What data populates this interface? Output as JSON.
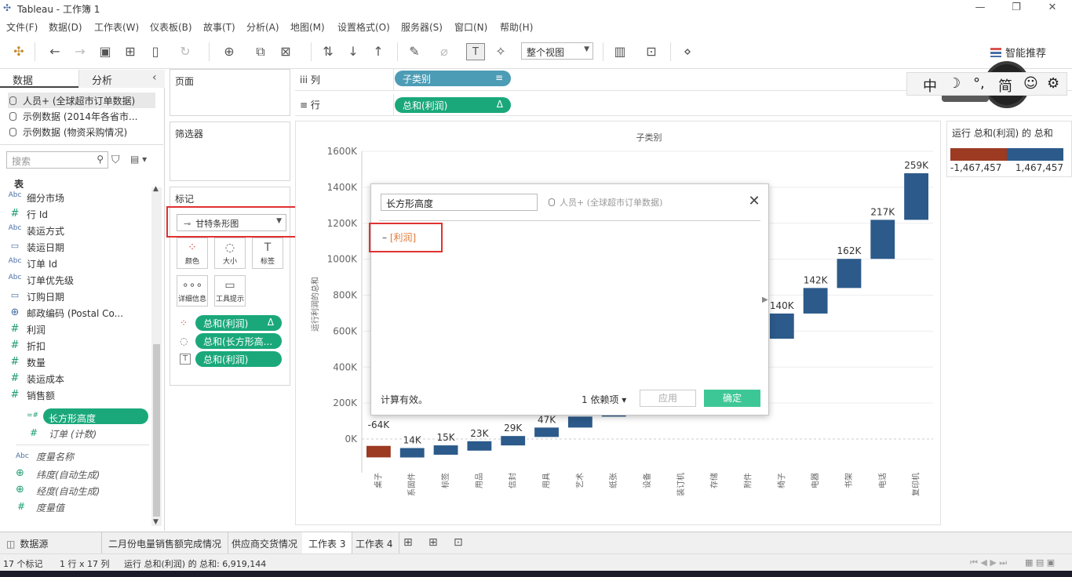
{
  "window": {
    "title": "Tableau - 工作簿 1",
    "minimize": "—",
    "restore": "❐",
    "close": "✕"
  },
  "menu": [
    "文件(F)",
    "数据(D)",
    "工作表(W)",
    "仪表板(B)",
    "故事(T)",
    "分析(A)",
    "地图(M)",
    "设置格式(O)",
    "服务器(S)",
    "窗口(N)",
    "帮助(H)"
  ],
  "toolbar": {
    "fit_view": "整个视图",
    "smart_recommend": "智能推荐"
  },
  "left_pane": {
    "tab_data": "数据",
    "tab_analytics": "分析",
    "collapse": "‹",
    "datasources": [
      "人员+ (全球超市订单数据)",
      "示例数据 (2014年各省市...",
      "示例数据 (物资采购情况)"
    ],
    "search_placeholder": "搜索",
    "section_table": "表",
    "fields": [
      {
        "type": "Abc",
        "name": "细分市场"
      },
      {
        "type": "#",
        "name": "行 Id"
      },
      {
        "type": "Abc",
        "name": "装运方式"
      },
      {
        "type": "▭",
        "name": "装运日期"
      },
      {
        "type": "Abc",
        "name": "订单 Id"
      },
      {
        "type": "Abc",
        "name": "订单优先级"
      },
      {
        "type": "▭",
        "name": "订购日期"
      },
      {
        "type": "⊕",
        "name": "邮政编码 (Postal Co..."
      },
      {
        "type": "#",
        "name": "利润"
      },
      {
        "type": "#",
        "name": "折扣"
      },
      {
        "type": "#",
        "name": "数量"
      },
      {
        "type": "#",
        "name": "装运成本"
      },
      {
        "type": "#",
        "name": "销售额"
      }
    ],
    "calc_field": "长方形高度",
    "calc_field_type": "=#",
    "count_field_type": "#",
    "count_field": "订单 (计数)",
    "measure_names_type": "Abc",
    "measure_names": "度量名称",
    "generated": [
      {
        "type": "⊕",
        "name": "纬度(自动生成)"
      },
      {
        "type": "⊕",
        "name": "经度(自动生成)"
      },
      {
        "type": "#",
        "name": "度量值"
      }
    ]
  },
  "shelves": {
    "pages": "页面",
    "filters": "筛选器",
    "marks": "标记",
    "marks_type": "甘特条形图",
    "mark_buttons": [
      "颜色",
      "大小",
      "标签",
      "详细信息",
      "工具提示"
    ],
    "mark_pills": [
      "总和(利润)",
      "总和(长方形高...",
      "总和(利润)"
    ],
    "delta": "Δ",
    "columns_label": "列",
    "rows_label": "行",
    "columns_pill": "子类别",
    "rows_pill": "总和(利润)"
  },
  "ime": {
    "items": [
      "中",
      "☽",
      "°,",
      "简",
      "☺",
      "⚙"
    ],
    "speed": "0K/s"
  },
  "legend": {
    "title": "运行 总和(利润) 的 总和",
    "min": "-1,467,457",
    "max": "1,467,457",
    "neg_color": "#9c3a22",
    "pos_color": "#2c5a8a"
  },
  "chart_data": {
    "type": "bar",
    "title": "子类别",
    "ylabel": "运行利润的总和",
    "ylim": [
      -100,
      1600
    ],
    "yticks": [
      "1600K",
      "1400K",
      "1200K",
      "1000K",
      "800K",
      "600K",
      "400K",
      "200K",
      "0K"
    ],
    "yticks_values": [
      1600,
      1400,
      1200,
      1000,
      800,
      600,
      400,
      200,
      0
    ],
    "categories": [
      "桌子",
      "系固件",
      "标签",
      "用品",
      "信封",
      "用具",
      "艺术",
      "纸张",
      "设备",
      "装订机",
      "存储",
      "附件",
      "椅子",
      "电器",
      "书架",
      "电话",
      "复印机"
    ],
    "labels": [
      "-64K",
      "14K",
      "15K",
      "23K",
      "29K",
      "47K",
      "",
      "",
      "",
      "",
      "",
      "",
      "140K",
      "142K",
      "162K",
      "217K",
      "259K"
    ],
    "start": [
      0,
      -64,
      -50,
      -35,
      -12,
      17,
      64,
      125,
      190,
      260,
      345,
      450,
      558,
      698,
      840,
      1002,
      1219
    ],
    "end": [
      -64,
      -50,
      -35,
      -12,
      17,
      64,
      125,
      190,
      260,
      345,
      450,
      558,
      698,
      840,
      1002,
      1219,
      1478
    ],
    "neg_color": "#9c3a22",
    "pos_color": "#2c5a8a"
  },
  "calc_dialog": {
    "name": "长方形高度",
    "datasource": "人员+ (全球超市订单数据)",
    "formula_prefix": "–",
    "formula_field": "[利润]",
    "valid": "计算有效。",
    "deps": "1 依赖项 ▾",
    "apply": "应用",
    "ok": "确定",
    "close": "✕"
  },
  "sheet_tabs": {
    "datasource": "数据源",
    "tabs": [
      "二月份电量销售额完成情况",
      "供应商交货情况",
      "工作表 3",
      "工作表 4"
    ],
    "active_index": 2
  },
  "status": {
    "marks": "17 个标记",
    "rows_cols": "1 行 x 17 列",
    "sum": "运行 总和(利润) 的 总和: 6,919,144"
  }
}
